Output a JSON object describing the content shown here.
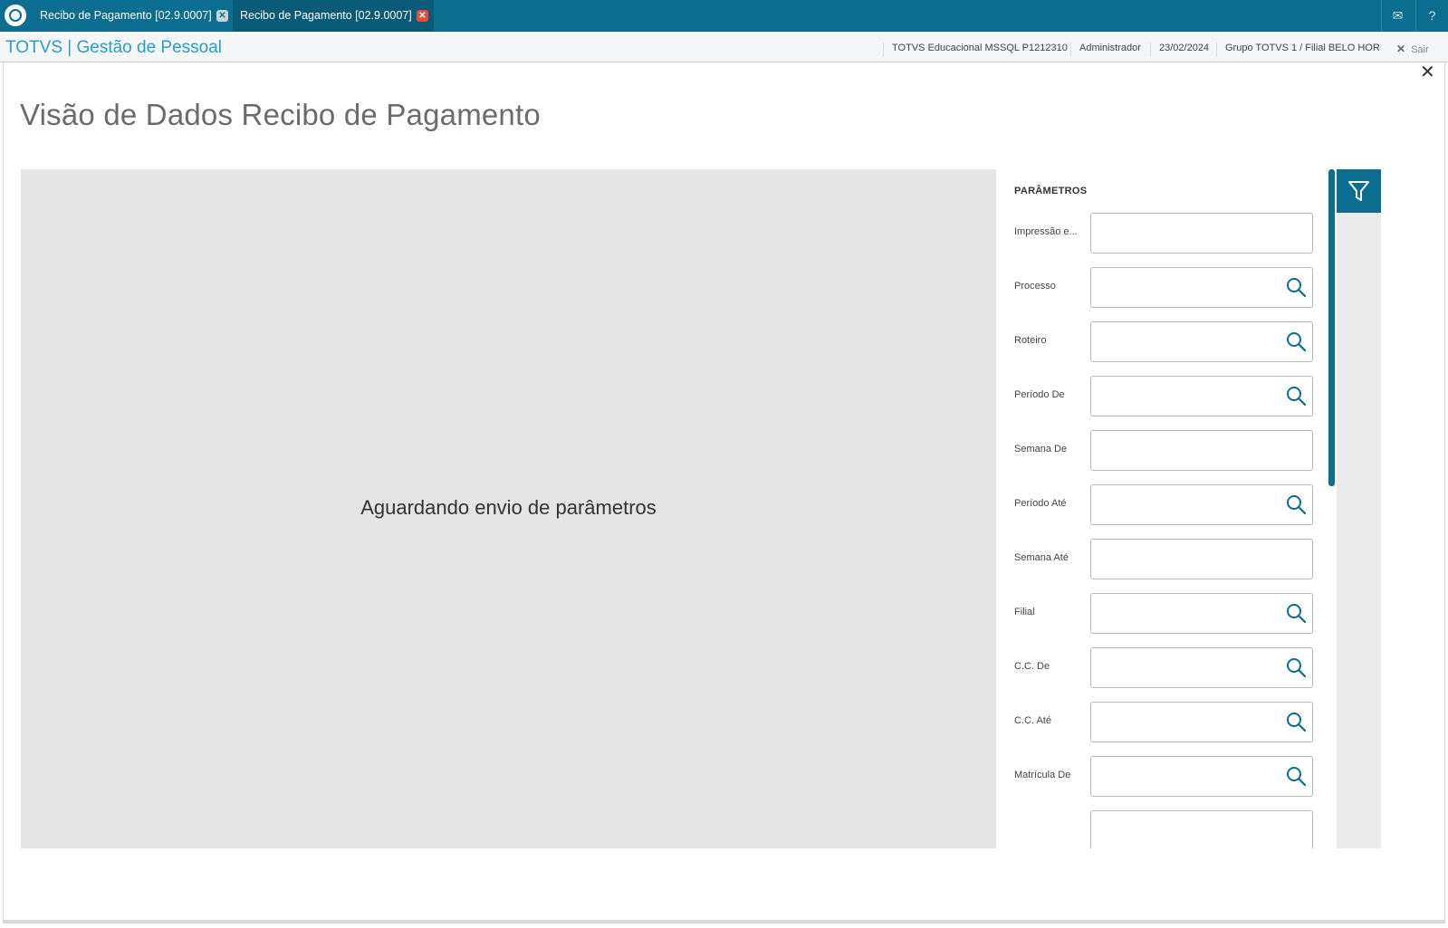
{
  "colors": {
    "brand": "#0b6d8f",
    "title_link": "#2a9ec9",
    "close_active": "#e74c3c"
  },
  "tabs": [
    {
      "label": "Recibo de Pagamento [02.9.0007]",
      "close": "✕"
    },
    {
      "label": "Recibo de Pagamento [02.9.0007]",
      "close": "✕"
    }
  ],
  "topbar": {
    "mail_icon": "✉",
    "help_icon": "?"
  },
  "appbar": {
    "title": "TOTVS | Gestão de Pessoal",
    "environment": "TOTVS Educacional MSSQL P1212310",
    "user": "Administrador",
    "date": "23/02/2024",
    "branch": "Grupo TOTVS 1 / Filial BELO HOR",
    "logout_label": "Sair",
    "logout_icon": "✕"
  },
  "panel": {
    "close_icon": "✕",
    "title": "Visão de Dados Recibo de Pagamento",
    "preview_message": "Aguardando envio de parâmetros"
  },
  "params": {
    "title": "PARÂMETROS",
    "fields": [
      {
        "label": "Impressão e...",
        "value": "",
        "lookup": false
      },
      {
        "label": "Processo",
        "value": "",
        "lookup": true
      },
      {
        "label": "Roteiro",
        "value": "",
        "lookup": true
      },
      {
        "label": "Período De",
        "value": "",
        "lookup": true
      },
      {
        "label": "Semana De",
        "value": "",
        "lookup": false
      },
      {
        "label": "Período Até",
        "value": "",
        "lookup": true
      },
      {
        "label": "Semana Até",
        "value": "",
        "lookup": false
      },
      {
        "label": "Filial",
        "value": "",
        "lookup": true
      },
      {
        "label": "C.C. De",
        "value": "",
        "lookup": true
      },
      {
        "label": "C.C. Até",
        "value": "",
        "lookup": true
      },
      {
        "label": "Matrícula De",
        "value": "",
        "lookup": true
      }
    ]
  },
  "icons": {
    "filter": "filter-icon",
    "lookup": "search-icon"
  }
}
